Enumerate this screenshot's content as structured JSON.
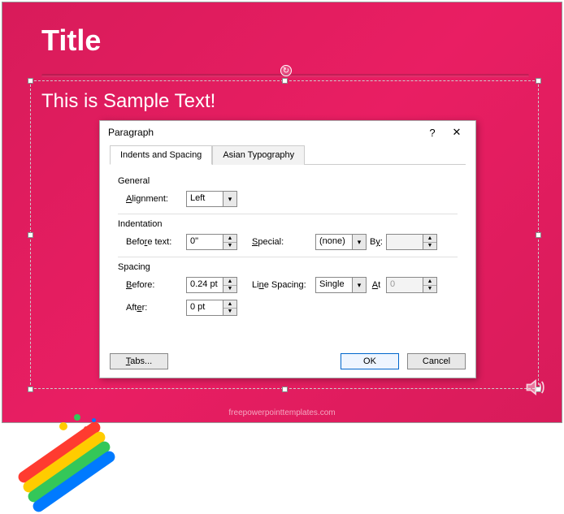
{
  "slide": {
    "title": "Title",
    "sample_text": "This is Sample Text!"
  },
  "watermark": "freepowerpointtemplates.com",
  "dialog": {
    "title": "Paragraph",
    "help": "?",
    "close": "✕",
    "tabs": {
      "indents": "Indents and Spacing",
      "asian": "Asian Typography"
    },
    "general": {
      "label": "General",
      "alignment_label": "Alignment:",
      "alignment_value": "Left"
    },
    "indentation": {
      "label": "Indentation",
      "before_text_label": "Before text:",
      "before_text_value": "0\"",
      "special_label": "Special:",
      "special_value": "(none)",
      "by_label": "By:",
      "by_value": ""
    },
    "spacing": {
      "label": "Spacing",
      "before_label": "Before:",
      "before_value": "0.24 pt",
      "after_label": "After:",
      "after_value": "0 pt",
      "line_spacing_label": "Line Spacing:",
      "line_spacing_value": "Single",
      "at_label": "At",
      "at_value": "0"
    },
    "buttons": {
      "tabs": "Tabs...",
      "ok": "OK",
      "cancel": "Cancel"
    }
  }
}
